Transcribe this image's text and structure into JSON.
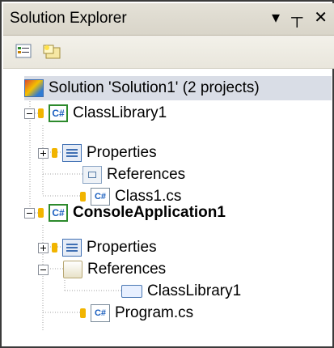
{
  "window": {
    "title": "Solution Explorer"
  },
  "titlebar_icons": [
    "dropdown-arrow-icon",
    "pin-icon",
    "close-icon"
  ],
  "toolbar": {
    "buttons": [
      "properties-icon",
      "show-all-files-icon"
    ]
  },
  "tree": {
    "solution": "Solution 'Solution1' (2 projects)",
    "project1": {
      "name": "ClassLibrary1",
      "items": [
        "Properties",
        "References",
        "Class1.cs"
      ]
    },
    "project2": {
      "name": "ConsoleApplication1",
      "items": [
        "Properties",
        "References",
        "Program.cs"
      ],
      "reference_item": "ClassLibrary1"
    }
  },
  "glyphs": {
    "close": "✕",
    "pin": "┬",
    "dropdown": "▾",
    "cs": "C#"
  }
}
